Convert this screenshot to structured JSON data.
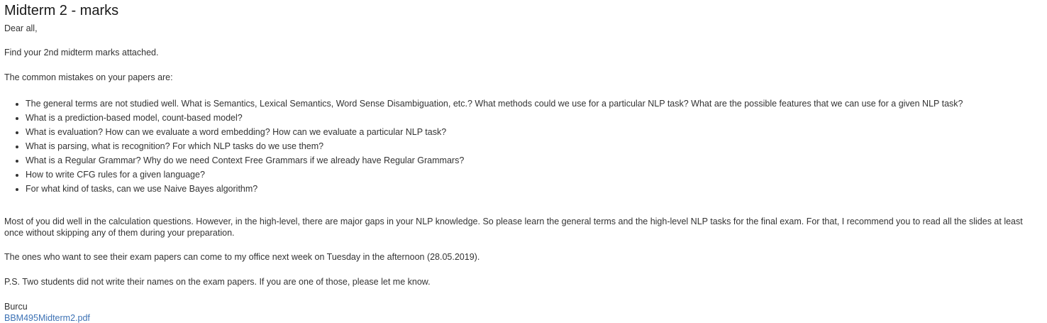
{
  "post": {
    "title": "Midterm 2 - marks",
    "greeting": "Dear all,",
    "intro": "Find your 2nd midterm marks attached.",
    "mistakes_heading": "The common mistakes on your papers are:",
    "mistakes": [
      "The general terms are not studied well. What is Semantics, Lexical Semantics, Word Sense Disambiguation, etc.? What methods could we use for a particular NLP task? What are the possible features that we can use for a given NLP task?",
      "What is a prediction-based model, count-based model?",
      "What is evaluation? How can we evaluate a word embedding? How can we evaluate a particular NLP task?",
      "What is parsing, what is recognition? For which NLP tasks do we use them?",
      "What is a Regular Grammar? Why do we need Context Free Grammars if we already have Regular Grammars?",
      "How to write CFG rules for a given language?",
      "For what kind of tasks, can we use Naive Bayes algorithm?"
    ],
    "feedback": "Most of you did well in the calculation questions. However, in the high-level, there are major gaps in your NLP knowledge. So please learn the general terms and the high-level NLP tasks for the final exam. For that, I recommend you to read all the slides at least once without skipping any of them during your preparation.",
    "office_hours": "The ones who want to see their exam papers can come to my office next week on Tuesday in the afternoon (28.05.2019).",
    "ps": "P.S. Two students did not write their names on the exam papers. If you are one of those, please let me know.",
    "signature": "Burcu",
    "attachment": "BBM495Midterm2.pdf"
  },
  "colors": {
    "text": "#333333",
    "title": "#1a1a1a",
    "link": "#3d72b5",
    "background": "#ffffff"
  }
}
